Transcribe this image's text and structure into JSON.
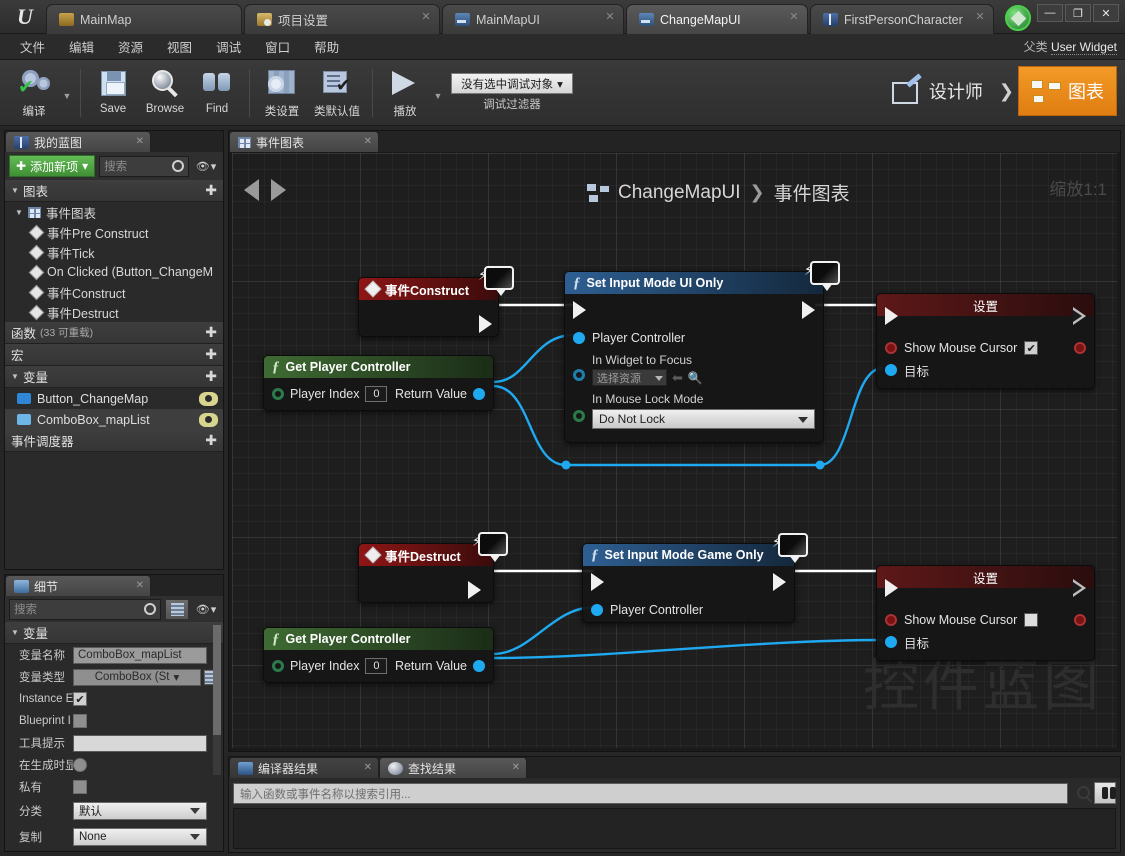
{
  "window": {
    "tabs": [
      {
        "label": "MainMap",
        "icon": "level-icon",
        "active": false,
        "closable": false
      },
      {
        "label": "项目设置",
        "icon": "project-settings-icon",
        "active": false,
        "closable": true
      },
      {
        "label": "MainMapUI",
        "icon": "widget-blueprint-icon",
        "active": false,
        "closable": true
      },
      {
        "label": "ChangeMapUI",
        "icon": "widget-blueprint-icon",
        "active": true,
        "closable": true
      },
      {
        "label": "FirstPersonCharacter",
        "icon": "blueprint-icon",
        "active": false,
        "closable": true
      }
    ],
    "controls": {
      "minimize": "—",
      "maximize": "❐",
      "close": "✕"
    }
  },
  "menubar": {
    "items": [
      "文件",
      "编辑",
      "资源",
      "视图",
      "调试",
      "窗口",
      "帮助"
    ],
    "parent_class_label": "父类",
    "parent_class_value": "User Widget"
  },
  "toolbar": {
    "buttons": [
      {
        "label": "编译",
        "icon": "compile-icon",
        "dropdown": true
      },
      {
        "label": "Save",
        "icon": "save-icon",
        "dropdown": false
      },
      {
        "label": "Browse",
        "icon": "browse-icon",
        "dropdown": false
      },
      {
        "label": "Find",
        "icon": "find-icon",
        "dropdown": false
      },
      {
        "label": "类设置",
        "icon": "class-settings-icon",
        "dropdown": false
      },
      {
        "label": "类默认值",
        "icon": "class-defaults-icon",
        "dropdown": false
      },
      {
        "label": "播放",
        "icon": "play-icon",
        "dropdown": true
      }
    ],
    "debug_object": "没有选中调试对象",
    "debug_filter_label": "调试过滤器",
    "mode_designer": "设计师",
    "mode_graph": "图表",
    "accent_orange": "#e88a1c"
  },
  "my_blueprint": {
    "tab_label": "我的蓝图",
    "add_new_label": "添加新项",
    "search_placeholder": "搜索",
    "sections": [
      {
        "title": "图表",
        "rows": [
          {
            "label": "事件图表",
            "icon": "graph-icon",
            "depth": 0
          },
          {
            "label": "事件Pre Construct",
            "icon": "event-icon",
            "depth": 1
          },
          {
            "label": "事件Tick",
            "icon": "event-icon",
            "depth": 1
          },
          {
            "label": "On Clicked (Button_ChangeM",
            "icon": "event-icon",
            "depth": 1
          },
          {
            "label": "事件Construct",
            "icon": "event-icon",
            "depth": 1
          },
          {
            "label": "事件Destruct",
            "icon": "event-icon",
            "depth": 1
          }
        ]
      },
      {
        "title": "函数",
        "sub": "(33 可重载)",
        "rows": []
      },
      {
        "title": "宏",
        "rows": []
      },
      {
        "title": "变量",
        "rows": [
          {
            "label": "Button_ChangeMap",
            "swatch": "#2f86d4",
            "selected": false
          },
          {
            "label": "ComboBox_mapList",
            "swatch": "#6fb6e8",
            "selected": true
          }
        ]
      },
      {
        "title": "事件调度器",
        "rows": []
      }
    ]
  },
  "details": {
    "tab_label": "细节",
    "search_placeholder": "搜索",
    "section_title": "变量",
    "rows": [
      {
        "label": "变量名称",
        "type": "text",
        "value": "ComboBox_mapList"
      },
      {
        "label": "变量类型",
        "type": "typedrop",
        "value": "ComboBox (St"
      },
      {
        "label": "Instance E",
        "type": "check",
        "value": true
      },
      {
        "label": "Blueprint I",
        "type": "check",
        "value": false
      },
      {
        "label": "工具提示",
        "type": "text",
        "value": ""
      },
      {
        "label": "在生成时显",
        "type": "radio",
        "value": false
      },
      {
        "label": "私有",
        "type": "check",
        "value": false
      },
      {
        "label": "分类",
        "type": "dropdown",
        "value": "默认"
      },
      {
        "label": "复制",
        "type": "dropdown",
        "value": "None"
      }
    ]
  },
  "graph": {
    "tab_label": "事件图表",
    "breadcrumb_root": "ChangeMapUI",
    "breadcrumb_leaf": "事件图表",
    "breadcrumb_sep": "❯",
    "zoom_label": "缩放1:1",
    "watermark": "控件蓝图",
    "nodes": [
      {
        "id": "event-construct",
        "kind": "event",
        "title": "事件Construct",
        "pins": []
      },
      {
        "id": "get-player-controller-1",
        "kind": "pure-function",
        "title": "Get Player Controller",
        "in_pin": "Player Index",
        "in_value": "0",
        "out_pin": "Return Value"
      },
      {
        "id": "set-input-mode-ui-only",
        "kind": "function",
        "title": "Set Input Mode UI Only",
        "pins": [
          {
            "label": "Player Controller",
            "type": "object"
          },
          {
            "label": "In Widget to Focus",
            "type": "object",
            "widget_value": "选择资源"
          },
          {
            "label": "In Mouse Lock Mode",
            "type": "enum",
            "enum_value": "Do Not Lock"
          }
        ]
      },
      {
        "id": "set-show-mouse-cursor-1",
        "kind": "setter",
        "title": "设置",
        "pins": [
          {
            "label": "Show Mouse Cursor",
            "type": "bool",
            "checked": true
          },
          {
            "label": "目标",
            "type": "object"
          }
        ]
      },
      {
        "id": "event-destruct",
        "kind": "event",
        "title": "事件Destruct",
        "pins": []
      },
      {
        "id": "get-player-controller-2",
        "kind": "pure-function",
        "title": "Get Player Controller",
        "in_pin": "Player Index",
        "in_value": "0",
        "out_pin": "Return Value"
      },
      {
        "id": "set-input-mode-game-only",
        "kind": "function",
        "title": "Set Input Mode Game Only",
        "pins": [
          {
            "label": "Player Controller",
            "type": "object"
          }
        ]
      },
      {
        "id": "set-show-mouse-cursor-2",
        "kind": "setter",
        "title": "设置",
        "pins": [
          {
            "label": "Show Mouse Cursor",
            "type": "bool",
            "checked": false
          },
          {
            "label": "目标",
            "type": "object"
          }
        ]
      }
    ],
    "wire_color_exec": "#ffffff",
    "wire_color_object": "#1ea9f0"
  },
  "bottom_panel": {
    "tabs": [
      {
        "label": "编译器结果",
        "icon": "compiler-results-icon",
        "active": false
      },
      {
        "label": "查找结果",
        "icon": "find-results-icon",
        "active": true
      }
    ],
    "search_placeholder": "输入函数或事件名称以搜索引用..."
  }
}
